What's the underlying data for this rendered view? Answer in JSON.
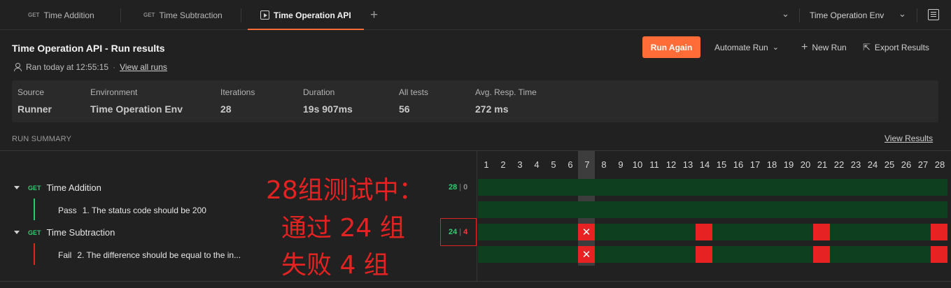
{
  "tabs": [
    {
      "method": "GET",
      "label": "Time Addition"
    },
    {
      "method": "GET",
      "label": "Time Subtraction"
    },
    {
      "method": "",
      "label": "Time Operation API"
    }
  ],
  "environment_selector": {
    "value": "Time Operation Env"
  },
  "header": {
    "title": "Time Operation API - Run results",
    "ran_at": "Ran today at 12:55:15",
    "separator": "·",
    "view_all_runs": "View all runs"
  },
  "actions": {
    "run_again": "Run Again",
    "automate_run": "Automate Run",
    "new_run": "New Run",
    "export_results": "Export Results"
  },
  "stats": [
    {
      "label": "Source",
      "value": "Runner"
    },
    {
      "label": "Environment",
      "value": "Time Operation Env"
    },
    {
      "label": "Iterations",
      "value": "28"
    },
    {
      "label": "Duration",
      "value": "19s 907ms"
    },
    {
      "label": "All tests",
      "value": "56"
    },
    {
      "label": "Avg. Resp. Time",
      "value": "272 ms"
    }
  ],
  "summary": {
    "title": "RUN SUMMARY",
    "view_results": "View Results",
    "iterations": [
      "1",
      "2",
      "3",
      "4",
      "5",
      "6",
      "7",
      "8",
      "9",
      "10",
      "11",
      "12",
      "13",
      "14",
      "15",
      "16",
      "17",
      "18",
      "19",
      "20",
      "21",
      "22",
      "23",
      "24",
      "25",
      "26",
      "27",
      "28"
    ],
    "requests": [
      {
        "method": "GET",
        "name": "Time Addition",
        "pass_count": "28",
        "fail_count": "0",
        "test": {
          "status": "Pass",
          "name": "1. The status code should be 200"
        },
        "failed_iterations": []
      },
      {
        "method": "GET",
        "name": "Time Subtraction",
        "pass_count": "24",
        "fail_count": "4",
        "test": {
          "status": "Fail",
          "name": "2. The difference should be equal to the in..."
        },
        "failed_iterations": [
          7,
          14,
          21,
          28
        ]
      }
    ]
  },
  "annotation": {
    "line1": "28组测试中：",
    "line2": "通过 24 组",
    "line3": "失败   4 组"
  },
  "colors": {
    "accent": "#ff6c37",
    "pass": "#2ecc71",
    "fail": "#e62222",
    "pass_bar": "#0e3f1e"
  }
}
